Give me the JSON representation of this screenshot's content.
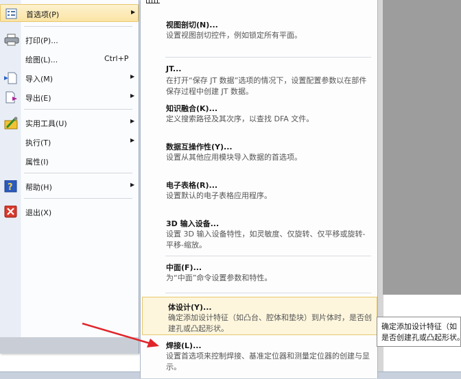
{
  "file_menu": {
    "items": [
      {
        "label": "首选项(P)",
        "icon": "preferences-icon",
        "submenu": true
      },
      {
        "label": "打印(P)...",
        "icon": "printer-icon"
      },
      {
        "label": "绘图(L)...",
        "shortcut": "Ctrl+P"
      },
      {
        "label": "导入(M)",
        "icon": "import-icon",
        "submenu": true
      },
      {
        "label": "导出(E)",
        "icon": "export-icon",
        "submenu": true
      },
      {
        "label": "实用工具(U)",
        "icon": "utilities-icon",
        "submenu": true
      },
      {
        "label": "执行(T)",
        "submenu": true
      },
      {
        "label": "属性(I)"
      },
      {
        "label": "帮助(H)",
        "icon": "help-icon",
        "submenu": true
      },
      {
        "label": "退出(X)",
        "icon": "exit-icon"
      }
    ]
  },
  "preferences_submenu": {
    "items": [
      {
        "title": "视图剖切(N)...",
        "desc": "设置视图剖切控件，例如锁定所有平面。"
      },
      {
        "title": "JT...",
        "desc": "在打开“保存 JT 数据”选项的情况下，设置配置参数以在部件保存过程中创建 JT 数据。"
      },
      {
        "title": "知识融合(K)...",
        "desc": "定义搜索路径及其次序，以查找 DFA 文件。"
      },
      {
        "title": "数据互操作性(Y)...",
        "desc": "设置从其他应用模块导入数据的首选项。"
      },
      {
        "title": "电子表格(R)...",
        "desc": "设置默认的电子表格应用程序。"
      },
      {
        "title": "3D 输入设备...",
        "desc": "设置 3D 输入设备特性，如灵敏度、仅旋转、仅平移或旋转-平移-缩放。"
      },
      {
        "title": "中面(F)...",
        "desc": "为“中面”命令设置参数和特性。"
      },
      {
        "title": "体设计(Y)...",
        "desc": "确定添加设计特征（如凸台、腔体和垫块）到片体时，是否创建孔或凸起形状。"
      },
      {
        "title": "焊接(L)...",
        "desc": "设置首选项来控制焊接、基准定位器和测量定位器的创建与显示。"
      }
    ]
  },
  "tooltip": {
    "line1": "确定添加设计特征（如",
    "line2": "是否创建孔或凸起形状。"
  },
  "colors": {
    "highlight_bg": "#fdf6dd",
    "highlight_border": "#e5c76b",
    "arrow": "#e0262b"
  }
}
